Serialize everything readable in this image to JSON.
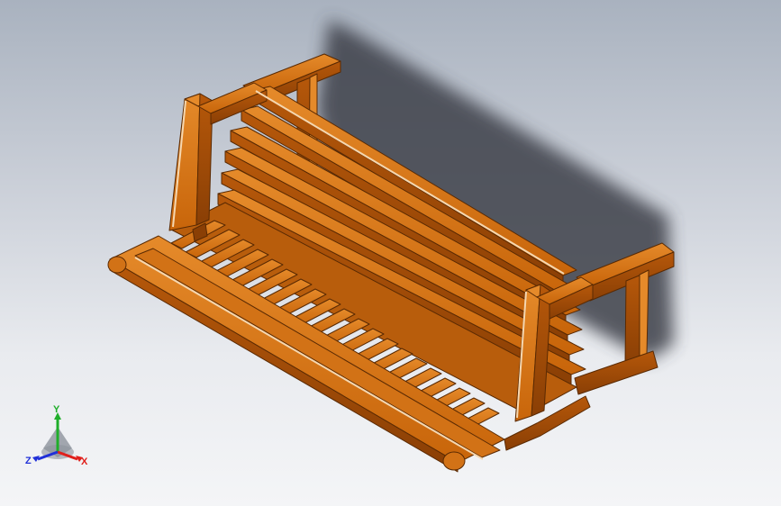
{
  "viewport": {
    "background_top": "#a9b2bf",
    "background_bottom": "#f4f5f7"
  },
  "model": {
    "wood_color": "#c8650a",
    "wood_dark": "#8a3f05",
    "wood_light": "#e58a2a",
    "highlight": "#f5d7b0",
    "shadow_color": "#3c4048"
  },
  "triad": {
    "x_label": "X",
    "y_label": "Y",
    "z_label": "Z",
    "x_color": "#e0201c",
    "y_color": "#1fae2a",
    "z_color": "#2030d8"
  }
}
